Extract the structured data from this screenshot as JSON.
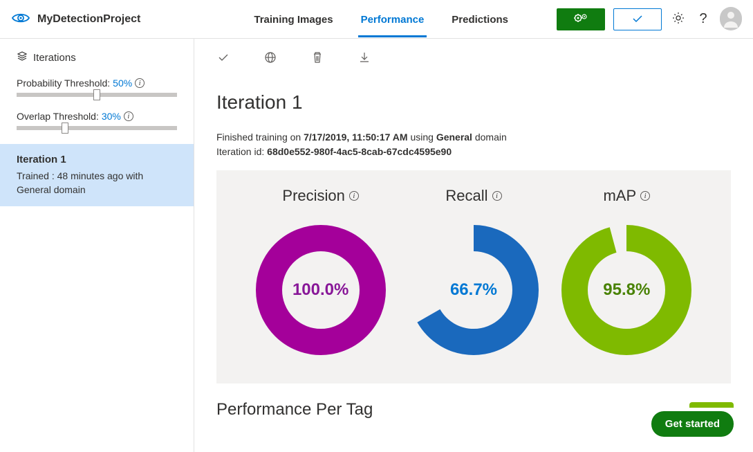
{
  "project_name": "MyDetectionProject",
  "tabs": {
    "training_images": "Training Images",
    "performance": "Performance",
    "predictions": "Predictions"
  },
  "sidebar": {
    "title": "Iterations",
    "prob_threshold": {
      "label": "Probability Threshold:",
      "value": "50%",
      "pos": 50
    },
    "overlap_threshold": {
      "label": "Overlap Threshold:",
      "value": "30%",
      "pos": 30
    },
    "iteration": {
      "name": "Iteration 1",
      "meta": "Trained : 48 minutes ago with General domain"
    }
  },
  "main": {
    "title": "Iteration 1",
    "finished_prefix": "Finished training on ",
    "finished_date": "7/17/2019, 11:50:17 AM",
    "finished_using": " using ",
    "finished_domain": "General",
    "finished_suffix": " domain",
    "iter_id_label": "Iteration id: ",
    "iter_id": "68d0e552-980f-4ac5-8cab-67cdc4595e90",
    "metrics": {
      "precision": {
        "label": "Precision",
        "value": 100.0,
        "display": "100.0%",
        "color": "#a4009a"
      },
      "recall": {
        "label": "Recall",
        "value": 66.7,
        "display": "66.7%",
        "color": "#1a69bd"
      },
      "map": {
        "label": "mAP",
        "value": 95.8,
        "display": "95.8%",
        "color": "#7fba00"
      }
    },
    "perf_per_tag": "Performance Per Tag"
  },
  "get_started": "Get started",
  "chart_data": [
    {
      "type": "pie",
      "title": "Precision",
      "values": [
        100.0
      ],
      "ylim": [
        0,
        100
      ],
      "color": "#a4009a"
    },
    {
      "type": "pie",
      "title": "Recall",
      "values": [
        66.7
      ],
      "ylim": [
        0,
        100
      ],
      "color": "#1a69bd"
    },
    {
      "type": "pie",
      "title": "mAP",
      "values": [
        95.8
      ],
      "ylim": [
        0,
        100
      ],
      "color": "#7fba00"
    }
  ]
}
